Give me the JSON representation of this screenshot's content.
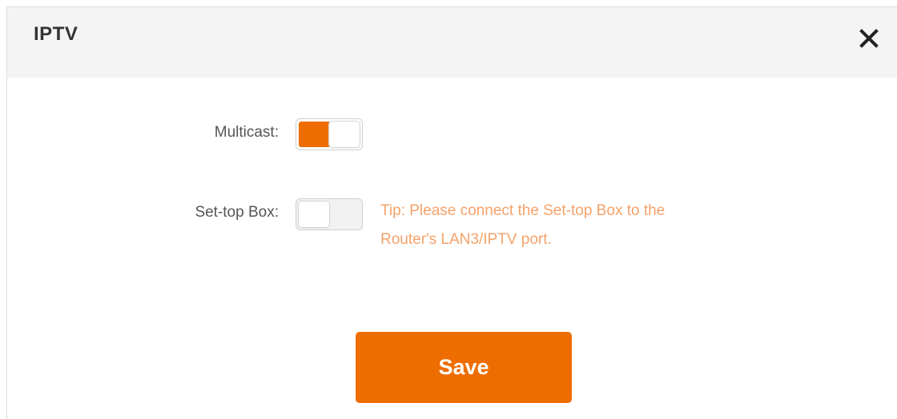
{
  "dialog": {
    "title": "IPTV",
    "close_icon": "close-icon"
  },
  "multicast": {
    "label": "Multicast:",
    "enabled": true
  },
  "settop_box": {
    "label": "Set-top Box:",
    "enabled": false,
    "tip_line1": "Tip: Please connect the Set-top Box to the",
    "tip_line2": "Router's LAN3/IPTV port."
  },
  "actions": {
    "save_label": "Save"
  },
  "colors": {
    "accent": "#ee6d00",
    "tip": "#f5a26a",
    "header_bg": "#f4f4f4"
  }
}
